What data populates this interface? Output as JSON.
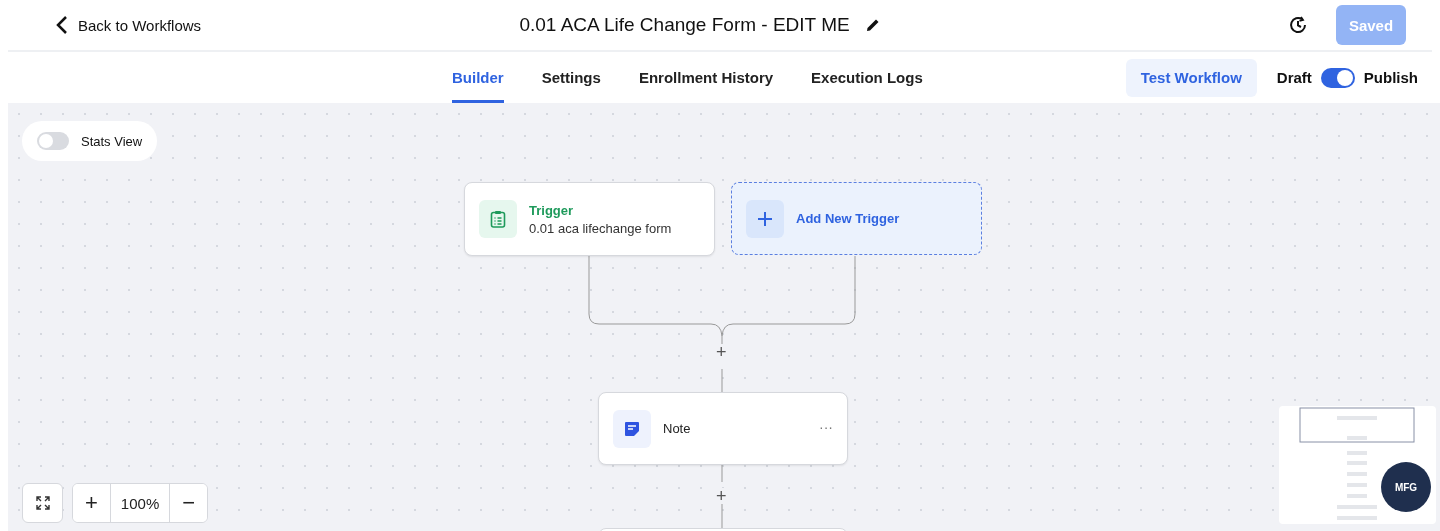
{
  "header": {
    "back_label": "Back to Workflows",
    "title": "0.01 ACA Life Change Form - EDIT ME",
    "save_button": {
      "label": "Saved",
      "disabled": true
    }
  },
  "tabs": [
    {
      "label": "Builder",
      "selected": true
    },
    {
      "label": "Settings",
      "selected": false
    },
    {
      "label": "Enrollment History",
      "selected": false
    },
    {
      "label": "Execution Logs",
      "selected": false
    }
  ],
  "test_button": "Test Workflow",
  "publish_toggle": {
    "off_label": "Draft",
    "on_label": "Publish",
    "on": true
  },
  "stats_view": {
    "label": "Stats View",
    "on": false
  },
  "nodes": [
    {
      "kind": "trigger",
      "title": "Trigger",
      "subtitle": "0.01 aca lifechange form"
    },
    {
      "kind": "add",
      "title": "Add New Trigger"
    },
    {
      "kind": "note",
      "title": "Note",
      "menu": "···"
    }
  ],
  "add_steps": [
    "+",
    "+"
  ],
  "zoom": {
    "zoom_in": "+",
    "level": "100%",
    "zoom_out": "−"
  },
  "chat_logo": "MFG"
}
